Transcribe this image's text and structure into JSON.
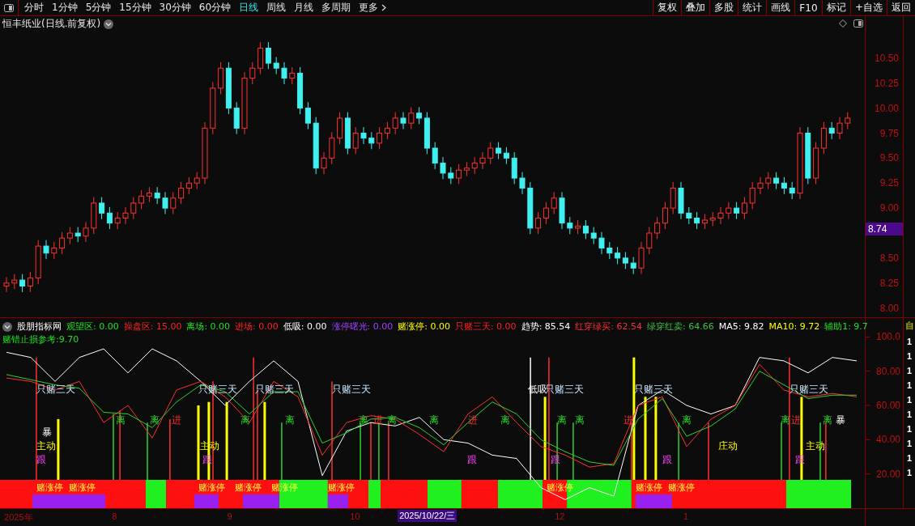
{
  "toolbar": {
    "periods": [
      {
        "label": "分时",
        "selected": false
      },
      {
        "label": "1分钟",
        "selected": false
      },
      {
        "label": "5分钟",
        "selected": false
      },
      {
        "label": "15分钟",
        "selected": false
      },
      {
        "label": "30分钟",
        "selected": false
      },
      {
        "label": "60分钟",
        "selected": false
      },
      {
        "label": "日线",
        "selected": true
      },
      {
        "label": "周线",
        "selected": false
      },
      {
        "label": "月线",
        "selected": false
      },
      {
        "label": "多周期",
        "selected": false
      },
      {
        "label": "更多",
        "selected": false,
        "kind": "menu"
      }
    ],
    "actions": [
      "复权",
      "叠加",
      "多股",
      "统计",
      "画线",
      "F10",
      "标记",
      "+自选",
      "返回"
    ]
  },
  "price_panel": {
    "title": "恒丰纸业(日线.前复权)",
    "current_price": "8.74",
    "chart_data": {
      "type": "candlestick",
      "categories": [
        null,
        null,
        null,
        null,
        null,
        null,
        null,
        null,
        null,
        null,
        null,
        null,
        null,
        null,
        null,
        null,
        null,
        null,
        null,
        null,
        null,
        null,
        null,
        null,
        null,
        null,
        null,
        null,
        null,
        null,
        null,
        null,
        null,
        null,
        null,
        null,
        null,
        null,
        null,
        null,
        null,
        null,
        null,
        null,
        null,
        null,
        null,
        null,
        null,
        null,
        null,
        null,
        null,
        null,
        null,
        null,
        null,
        null,
        null,
        null,
        null,
        null,
        null,
        null,
        null,
        null,
        null,
        null,
        null,
        null,
        null,
        null,
        null,
        null,
        null,
        null,
        null,
        null,
        null,
        null,
        null,
        null,
        null,
        null,
        null,
        null,
        null,
        null,
        null,
        null,
        null,
        null,
        null,
        null,
        null,
        null,
        null,
        null,
        null,
        null,
        null,
        null,
        null,
        null,
        null,
        null,
        null
      ],
      "ohlc": [
        [
          8.22,
          8.31,
          8.16,
          8.25
        ],
        [
          8.25,
          8.34,
          8.19,
          8.28
        ],
        [
          8.28,
          8.34,
          8.16,
          8.22
        ],
        [
          8.22,
          8.36,
          8.16,
          8.3
        ],
        [
          8.3,
          8.68,
          8.24,
          8.62
        ],
        [
          8.62,
          8.68,
          8.49,
          8.55
        ],
        [
          8.55,
          8.66,
          8.49,
          8.6
        ],
        [
          8.6,
          8.76,
          8.54,
          8.7
        ],
        [
          8.7,
          8.81,
          8.64,
          8.75
        ],
        [
          8.75,
          8.81,
          8.66,
          8.72
        ],
        [
          8.72,
          8.86,
          8.66,
          8.8
        ],
        [
          8.8,
          9.11,
          8.74,
          9.05
        ],
        [
          9.05,
          9.11,
          8.89,
          8.95
        ],
        [
          8.95,
          9.01,
          8.79,
          8.85
        ],
        [
          8.85,
          8.96,
          8.79,
          8.9
        ],
        [
          8.9,
          9.01,
          8.84,
          8.95
        ],
        [
          8.95,
          9.11,
          8.89,
          9.05
        ],
        [
          9.05,
          9.18,
          8.99,
          9.12
        ],
        [
          9.12,
          9.21,
          9.06,
          9.15
        ],
        [
          9.15,
          9.21,
          9.04,
          9.1
        ],
        [
          9.1,
          9.16,
          8.94,
          9.0
        ],
        [
          9.0,
          9.16,
          8.94,
          9.1
        ],
        [
          9.1,
          9.26,
          9.04,
          9.2
        ],
        [
          9.2,
          9.31,
          9.14,
          9.25
        ],
        [
          9.25,
          9.36,
          9.19,
          9.3
        ],
        [
          9.3,
          9.86,
          9.24,
          9.8
        ],
        [
          9.8,
          10.26,
          9.74,
          10.2
        ],
        [
          10.2,
          10.46,
          10.14,
          10.4
        ],
        [
          10.4,
          10.46,
          9.94,
          10.0
        ],
        [
          10.0,
          10.06,
          9.74,
          9.8
        ],
        [
          9.8,
          10.36,
          9.74,
          10.3
        ],
        [
          10.3,
          10.46,
          10.24,
          10.4
        ],
        [
          10.4,
          10.66,
          10.34,
          10.6
        ],
        [
          10.6,
          10.66,
          10.39,
          10.45
        ],
        [
          10.45,
          10.51,
          10.34,
          10.4
        ],
        [
          10.4,
          10.46,
          10.24,
          10.3
        ],
        [
          10.3,
          10.41,
          10.24,
          10.35
        ],
        [
          10.35,
          10.41,
          9.94,
          10.0
        ],
        [
          10.0,
          10.06,
          9.79,
          9.85
        ],
        [
          9.85,
          9.91,
          9.34,
          9.4
        ],
        [
          9.4,
          9.56,
          9.34,
          9.5
        ],
        [
          9.5,
          9.76,
          9.44,
          9.7
        ],
        [
          9.7,
          9.96,
          9.64,
          9.9
        ],
        [
          9.9,
          9.96,
          9.54,
          9.6
        ],
        [
          9.6,
          9.81,
          9.54,
          9.75
        ],
        [
          9.75,
          9.81,
          9.64,
          9.7
        ],
        [
          9.7,
          9.76,
          9.59,
          9.65
        ],
        [
          9.65,
          9.81,
          9.59,
          9.75
        ],
        [
          9.75,
          9.86,
          9.69,
          9.8
        ],
        [
          9.8,
          9.96,
          9.74,
          9.9
        ],
        [
          9.9,
          9.96,
          9.79,
          9.85
        ],
        [
          9.85,
          10.01,
          9.79,
          9.95
        ],
        [
          9.95,
          10.01,
          9.84,
          9.9
        ],
        [
          9.9,
          9.96,
          9.54,
          9.6
        ],
        [
          9.6,
          9.66,
          9.39,
          9.45
        ],
        [
          9.45,
          9.51,
          9.29,
          9.35
        ],
        [
          9.35,
          9.41,
          9.24,
          9.3
        ],
        [
          9.3,
          9.44,
          9.24,
          9.38
        ],
        [
          9.38,
          9.46,
          9.32,
          9.4
        ],
        [
          9.4,
          9.51,
          9.34,
          9.45
        ],
        [
          9.45,
          9.56,
          9.39,
          9.5
        ],
        [
          9.5,
          9.66,
          9.44,
          9.6
        ],
        [
          9.6,
          9.66,
          9.49,
          9.55
        ],
        [
          9.55,
          9.61,
          9.44,
          9.5
        ],
        [
          9.5,
          9.56,
          9.24,
          9.3
        ],
        [
          9.3,
          9.36,
          9.14,
          9.2
        ],
        [
          9.2,
          9.26,
          8.74,
          8.8
        ],
        [
          8.8,
          8.96,
          8.74,
          8.9
        ],
        [
          8.9,
          9.06,
          8.84,
          9.0
        ],
        [
          9.0,
          9.16,
          8.94,
          9.1
        ],
        [
          9.1,
          9.16,
          8.79,
          8.85
        ],
        [
          8.85,
          8.91,
          8.74,
          8.8
        ],
        [
          8.8,
          8.88,
          8.74,
          8.82
        ],
        [
          8.82,
          8.88,
          8.69,
          8.75
        ],
        [
          8.75,
          8.81,
          8.64,
          8.7
        ],
        [
          8.7,
          8.76,
          8.54,
          8.6
        ],
        [
          8.6,
          8.66,
          8.49,
          8.55
        ],
        [
          8.55,
          8.61,
          8.44,
          8.5
        ],
        [
          8.5,
          8.56,
          8.39,
          8.45
        ],
        [
          8.45,
          8.51,
          8.34,
          8.4
        ],
        [
          8.4,
          8.66,
          8.34,
          8.6
        ],
        [
          8.6,
          8.81,
          8.54,
          8.75
        ],
        [
          8.75,
          8.91,
          8.69,
          8.85
        ],
        [
          8.85,
          9.06,
          8.79,
          9.0
        ],
        [
          9.0,
          9.26,
          8.94,
          9.2
        ],
        [
          9.2,
          9.26,
          8.89,
          8.95
        ],
        [
          8.95,
          9.01,
          8.84,
          8.9
        ],
        [
          8.9,
          8.96,
          8.79,
          8.85
        ],
        [
          8.85,
          8.94,
          8.79,
          8.88
        ],
        [
          8.88,
          8.96,
          8.82,
          8.9
        ],
        [
          8.9,
          9.01,
          8.84,
          8.95
        ],
        [
          8.95,
          9.06,
          8.89,
          9.0
        ],
        [
          9.0,
          9.06,
          8.89,
          8.95
        ],
        [
          8.95,
          9.11,
          8.89,
          9.05
        ],
        [
          9.05,
          9.26,
          8.99,
          9.2
        ],
        [
          9.2,
          9.31,
          9.14,
          9.25
        ],
        [
          9.25,
          9.36,
          9.19,
          9.3
        ],
        [
          9.3,
          9.36,
          9.19,
          9.25
        ],
        [
          9.25,
          9.31,
          9.14,
          9.2
        ],
        [
          9.2,
          9.26,
          9.09,
          9.15
        ],
        [
          9.15,
          9.81,
          9.09,
          9.75
        ],
        [
          9.75,
          9.81,
          9.24,
          9.3
        ],
        [
          9.3,
          9.66,
          9.24,
          9.6
        ],
        [
          9.6,
          9.86,
          9.54,
          9.8
        ],
        [
          9.8,
          9.86,
          9.69,
          9.75
        ],
        [
          9.75,
          9.91,
          9.69,
          9.85
        ],
        [
          9.85,
          9.96,
          9.79,
          9.9
        ]
      ],
      "ylim": [
        7.9,
        10.92
      ],
      "yticks": [
        {
          "value": 10.5,
          "label": "10.50"
        },
        {
          "value": 10.25,
          "label": "10.25"
        },
        {
          "value": 10,
          "label": "10.00"
        },
        {
          "value": 9.75,
          "label": "9.75"
        },
        {
          "value": 9.5,
          "label": "9.50"
        },
        {
          "value": 9.25,
          "label": "9.25"
        },
        {
          "value": 9,
          "label": "9.00"
        },
        {
          "value": 8.5,
          "label": "8.50"
        },
        {
          "value": 8.25,
          "label": "8.25"
        },
        {
          "value": 8,
          "label": "8.00"
        }
      ]
    }
  },
  "indicator_panel": {
    "name": "股朋指标网",
    "readings": [
      {
        "label": "观望区:",
        "value": "0.00",
        "kind": "watch"
      },
      {
        "label": "操盘区:",
        "value": "15.00",
        "kind": "operate"
      },
      {
        "label": "离场:",
        "value": "0.00",
        "kind": "exit"
      },
      {
        "label": "进场:",
        "value": "0.00",
        "kind": "entry"
      },
      {
        "label": "低吸:",
        "value": "0.00",
        "kind": "dip"
      },
      {
        "label": "涨停曙光:",
        "value": "0.00",
        "kind": "dawn"
      },
      {
        "label": "赌涨停:",
        "value": "0.00",
        "kind": "bet"
      },
      {
        "label": "只赌三天:",
        "value": "0.00",
        "kind": "threeday"
      },
      {
        "label": "趋势:",
        "value": "85.54",
        "kind": "trend"
      },
      {
        "label": "红穿绿买:",
        "value": "62.54",
        "kind": "buy"
      },
      {
        "label": "绿穿红卖:",
        "value": "64.66",
        "kind": "sell"
      },
      {
        "label": "MA5:",
        "value": "9.82",
        "kind": "ma"
      },
      {
        "label": "MA10:",
        "value": "9.72",
        "kind": "ma10"
      },
      {
        "label": "辅助1:",
        "value": "9.7",
        "kind": "aux"
      }
    ],
    "stop_loss": "赌错止损参考:9.70",
    "chart_data": {
      "type": "line",
      "series": [
        {
          "color": "#ffffff",
          "values": [
            91,
            88,
            74,
            88,
            93,
            79,
            93,
            86,
            74,
            60,
            74,
            86,
            74,
            19,
            45,
            50,
            48,
            53,
            40,
            38,
            31,
            29,
            12,
            5,
            12,
            7,
            60,
            69,
            60,
            55,
            60,
            88,
            86,
            79,
            88,
            86
          ]
        },
        {
          "color": "#ff3030",
          "values": [
            76,
            74,
            69,
            74,
            50,
            60,
            41,
            69,
            74,
            65,
            50,
            74,
            65,
            31,
            50,
            54,
            52,
            43,
            33,
            55,
            65,
            50,
            36,
            31,
            24,
            26,
            60,
            65,
            36,
            52,
            60,
            84,
            69,
            65,
            67,
            65
          ]
        },
        {
          "color": "#30d030",
          "values": [
            78,
            75,
            72,
            70,
            56,
            55,
            47,
            62,
            72,
            68,
            55,
            68,
            68,
            38,
            44,
            52,
            53,
            47,
            37,
            50,
            62,
            55,
            40,
            33,
            27,
            25,
            52,
            64,
            42,
            48,
            58,
            80,
            72,
            64,
            66,
            66
          ]
        }
      ],
      "ylim": [
        0,
        111
      ],
      "yticks": [
        {
          "value": 100,
          "label": "100.0"
        },
        {
          "value": 80,
          "label": "80.00"
        },
        {
          "value": 60,
          "label": "60.00"
        },
        {
          "value": 40,
          "label": "40.00"
        },
        {
          "value": 20,
          "label": "20.00"
        }
      ]
    },
    "signal_labels": [
      {
        "label": "只赌三天",
        "kind": "threeday"
      },
      {
        "label": "主动",
        "kind": "active"
      },
      {
        "label": "跟",
        "kind": "follow"
      },
      {
        "label": "暴",
        "kind": "surge"
      },
      {
        "label": "离",
        "kind": "exit"
      },
      {
        "label": "离",
        "kind": "exit"
      },
      {
        "label": "进",
        "kind": "entry"
      },
      {
        "label": "只赌三天",
        "kind": "threeday"
      },
      {
        "label": "主动",
        "kind": "active"
      },
      {
        "label": "跟",
        "kind": "follow"
      },
      {
        "label": "离",
        "kind": "exit"
      },
      {
        "label": "只赌三天",
        "kind": "threeday"
      },
      {
        "label": "离",
        "kind": "exit"
      },
      {
        "label": "只赌三天",
        "kind": "threeday"
      },
      {
        "label": "离",
        "kind": "exit"
      },
      {
        "label": "进",
        "kind": "entry"
      },
      {
        "label": "离",
        "kind": "exit"
      },
      {
        "label": "离",
        "kind": "exit"
      },
      {
        "label": "跟",
        "kind": "follow"
      },
      {
        "label": "进",
        "kind": "entry"
      },
      {
        "label": "离",
        "kind": "exit"
      },
      {
        "label": "低吸",
        "kind": "dip"
      },
      {
        "label": "只赌三天",
        "kind": "threeday"
      },
      {
        "label": "跟",
        "kind": "follow"
      },
      {
        "label": "离",
        "kind": "exit"
      },
      {
        "label": "离",
        "kind": "exit"
      },
      {
        "label": "进",
        "kind": "entry"
      },
      {
        "label": "只赌三天",
        "kind": "threeday"
      },
      {
        "label": "跟",
        "kind": "follow"
      },
      {
        "label": "离",
        "kind": "exit"
      },
      {
        "label": "庄动",
        "kind": "active"
      },
      {
        "label": "离",
        "kind": "exit"
      },
      {
        "label": "只赌三天",
        "kind": "threeday"
      },
      {
        "label": "进",
        "kind": "entry"
      },
      {
        "label": "跟",
        "kind": "follow"
      },
      {
        "label": "主动",
        "kind": "active"
      },
      {
        "label": "离",
        "kind": "exit"
      },
      {
        "label": "暴",
        "kind": "surge"
      }
    ],
    "band_labels": [
      "赌涨停",
      "赌涨停",
      "赌涨停",
      "赌涨停",
      "赌涨停",
      "赌涨停",
      "赌涨停",
      "赌涨停",
      "赌涨停"
    ]
  },
  "time_axis": [
    {
      "label": "2025年",
      "selected": false
    },
    {
      "label": "8",
      "selected": false
    },
    {
      "label": "9",
      "selected": false
    },
    {
      "label": "10",
      "selected": false
    },
    {
      "label": "2025/10/22/三",
      "selected": true
    },
    {
      "label": "12",
      "selected": false
    },
    {
      "label": "1",
      "selected": false
    }
  ],
  "side_strip": {
    "tag": "自",
    "rows": [
      "1",
      "1",
      "1",
      "1",
      "1",
      "1",
      "1",
      "1",
      "1",
      "1"
    ]
  }
}
